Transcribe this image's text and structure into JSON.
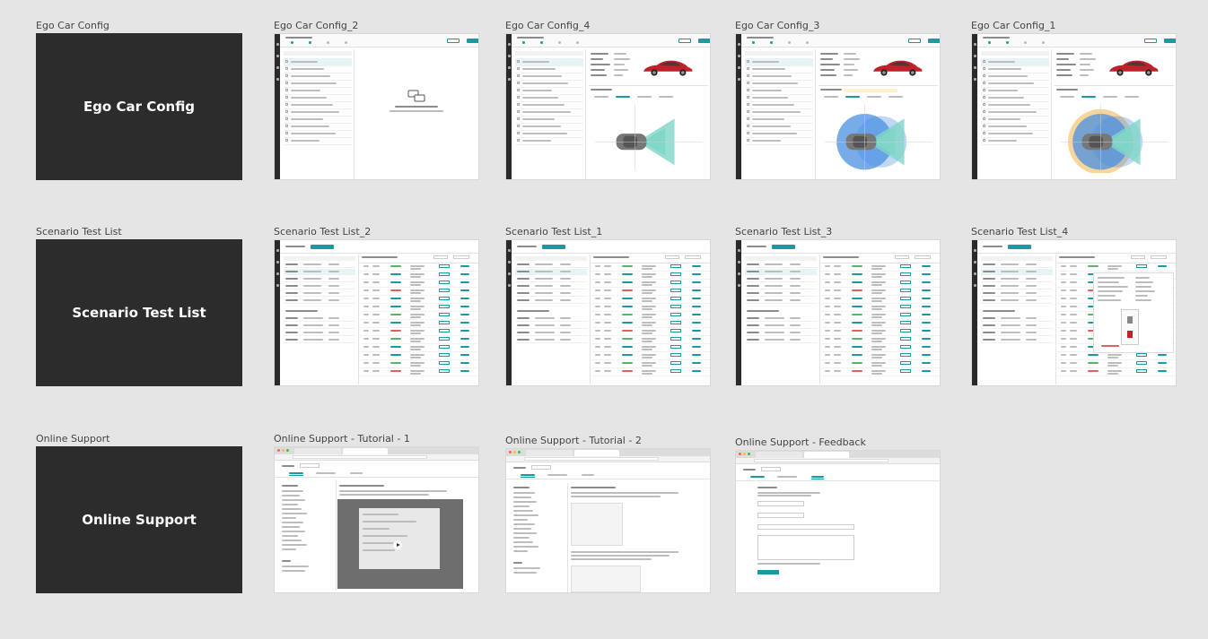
{
  "rows": [
    {
      "cover": {
        "label": "Ego Car Config",
        "text": "Ego Car Config"
      },
      "screens": [
        {
          "label": "Ego Car Config_2",
          "type": "ego-empty"
        },
        {
          "label": "Ego Car Config_4",
          "type": "ego-car"
        },
        {
          "label": "Ego Car Config_3",
          "type": "ego-circle"
        },
        {
          "label": "Ego Car Config_1",
          "type": "ego-full"
        }
      ]
    },
    {
      "cover": {
        "label": "Scenario Test List",
        "text": "Scenario Test List"
      },
      "screens": [
        {
          "label": "Scenario Test List_2",
          "type": "list"
        },
        {
          "label": "Scenario Test List_1",
          "type": "list"
        },
        {
          "label": "Scenario Test List_3",
          "type": "list"
        },
        {
          "label": "Scenario Test List_4",
          "type": "list-detail"
        }
      ]
    },
    {
      "cover": {
        "label": "Online Support",
        "text": "Online Support"
      },
      "screens": [
        {
          "label": "Online Support - Tutorial - 1",
          "type": "support-video"
        },
        {
          "label": "Online Support - Tutorial - 2",
          "type": "support-doc"
        },
        {
          "label": "Online Support - Feedback",
          "type": "support-form"
        }
      ]
    }
  ],
  "colors": {
    "canvas": "#e5e5e5",
    "cover": "#2c2c2c",
    "accent": "#1a9aa0",
    "car": "#c0222b",
    "sensor_blue": "#4a90e2",
    "sensor_teal": "#7fd6c8",
    "sensor_orange": "#f0b34a"
  }
}
